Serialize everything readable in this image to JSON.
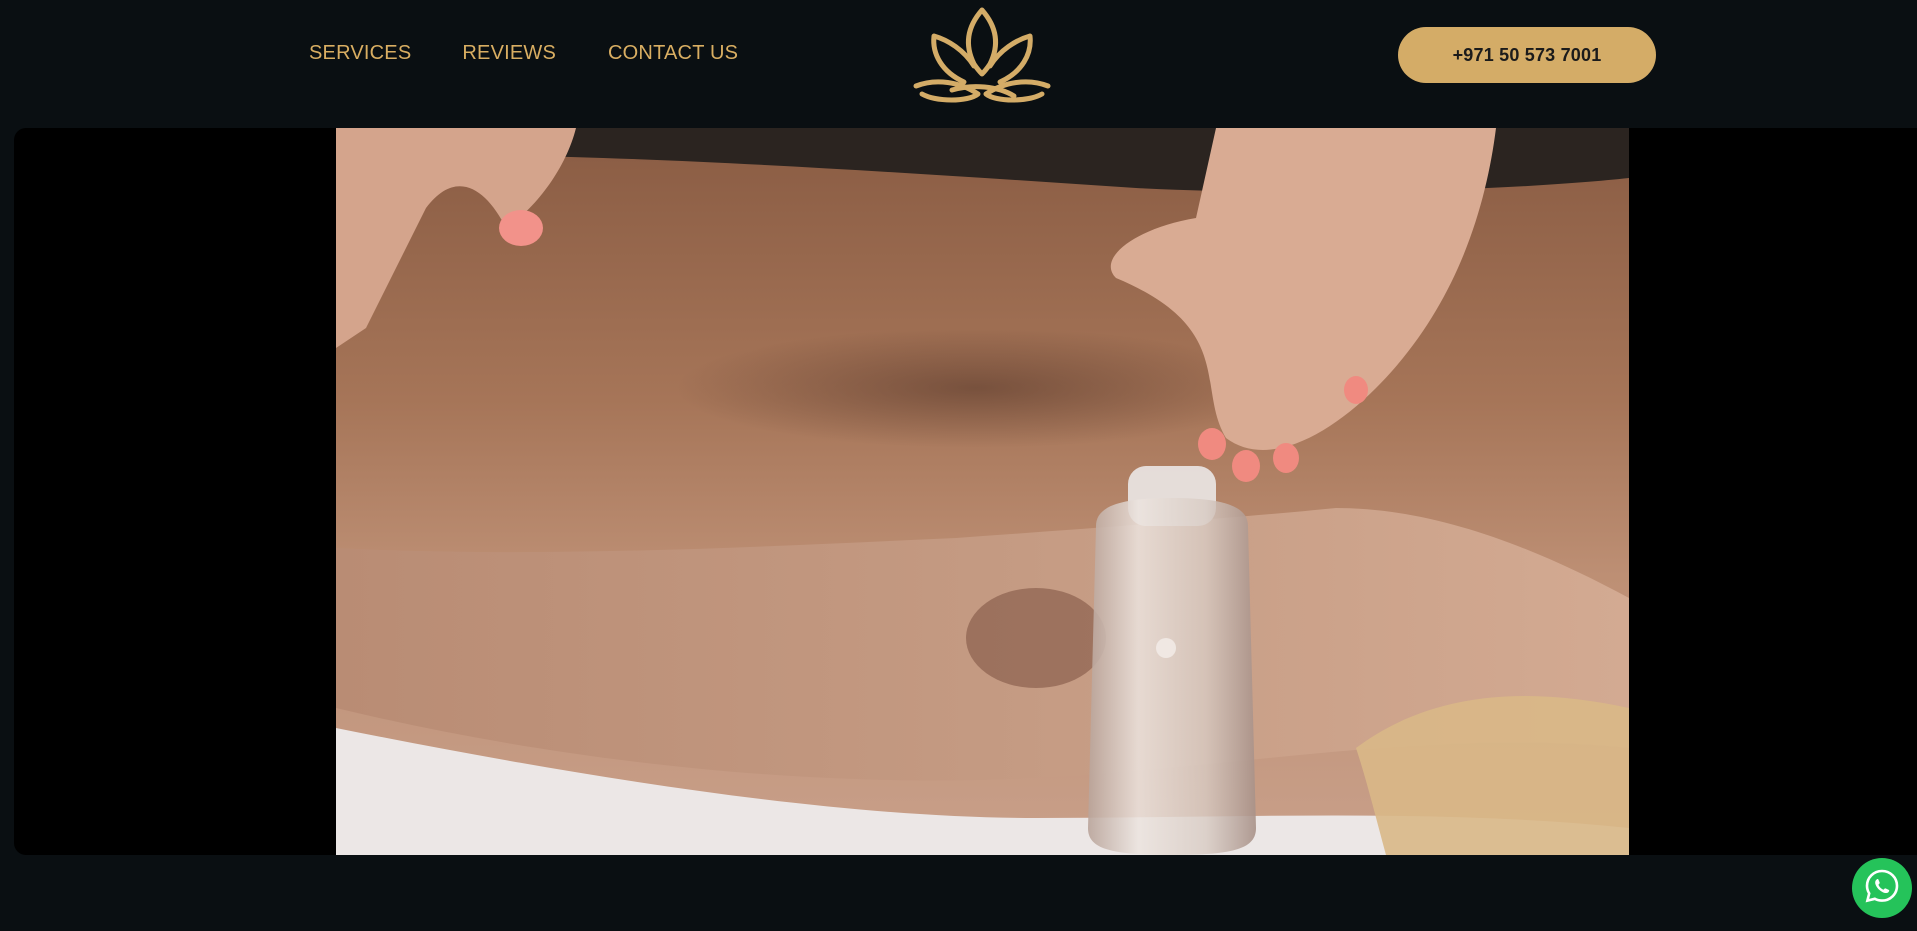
{
  "nav": {
    "items": [
      {
        "label": "SERVICES"
      },
      {
        "label": "REVIEWS"
      },
      {
        "label": "CONTACT US"
      }
    ]
  },
  "header": {
    "logo_icon": "lotus-icon",
    "phone_label": "+971 50 573 7001"
  },
  "hero": {
    "media": "massage-video",
    "icon": "oil-bottle"
  },
  "floating": {
    "whatsapp_icon": "whatsapp-icon"
  },
  "colors": {
    "background": "#0a0f12",
    "accent_gold": "#d4ac67",
    "nav_text": "#d9ae62",
    "whatsapp_green": "#25c35a"
  }
}
